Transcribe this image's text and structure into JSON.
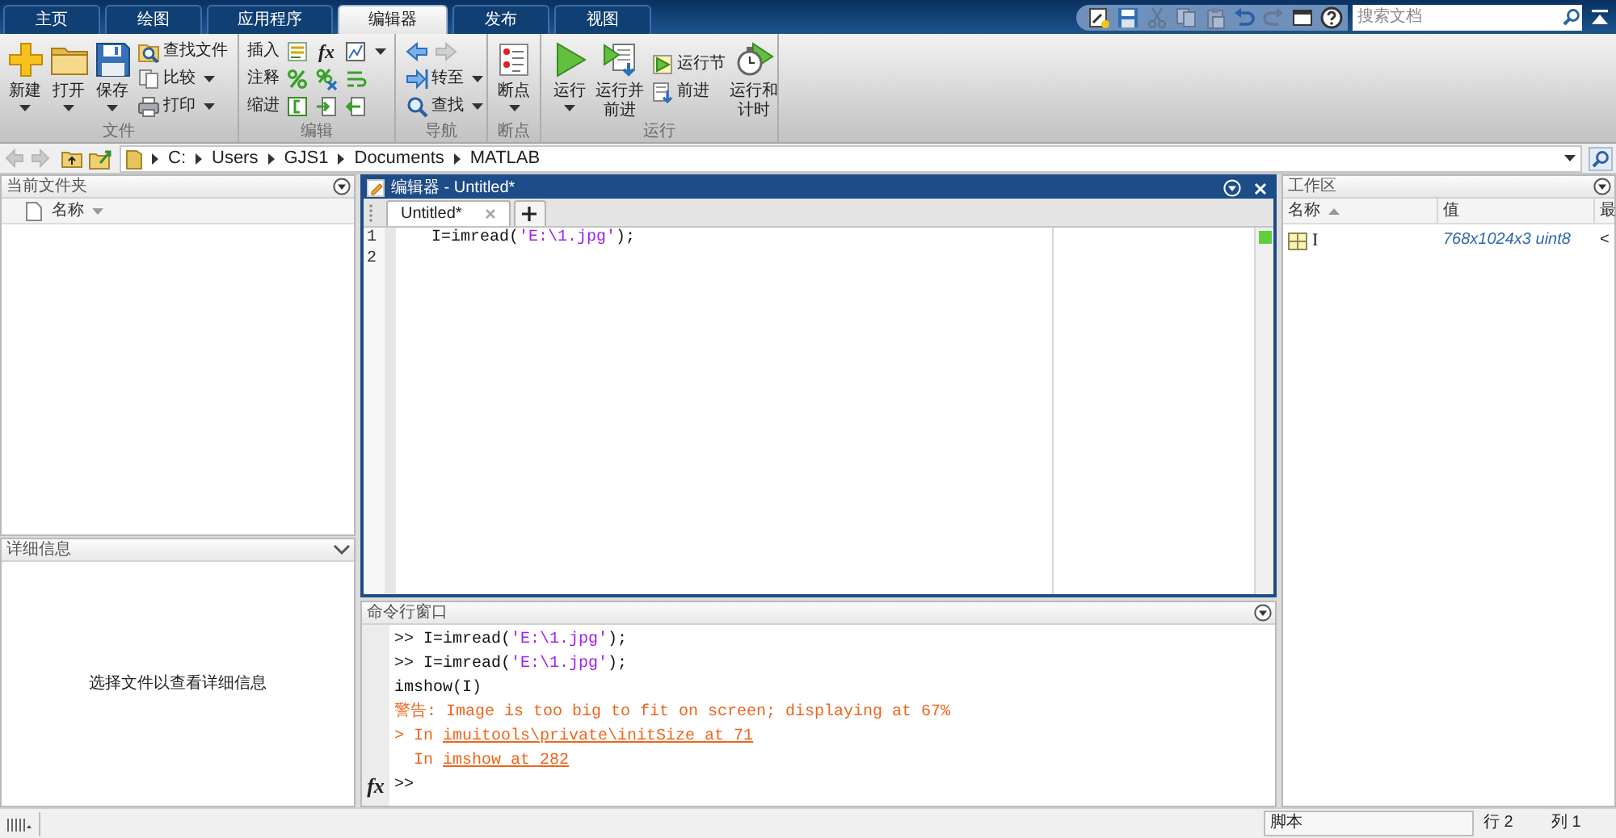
{
  "ribbon_tabs": [
    {
      "label": "主页",
      "selected": false
    },
    {
      "label": "绘图",
      "selected": false
    },
    {
      "label": "应用程序",
      "selected": false
    },
    {
      "label": "编辑器",
      "selected": true
    },
    {
      "label": "发布",
      "selected": false
    },
    {
      "label": "视图",
      "selected": false
    }
  ],
  "quick_access_toolbar": [
    {
      "disabled": false
    },
    {
      "disabled": false
    },
    {
      "disabled": true
    },
    {
      "disabled": true
    },
    {
      "disabled": true
    },
    {
      "disabled": false
    },
    {
      "disabled": true
    },
    {
      "disabled": false
    },
    {
      "disabled": false
    }
  ],
  "documentation_search": {
    "placeholder": "搜索文档"
  },
  "toolstrip": {
    "groups": [
      {
        "label": "文件",
        "items": [
          {
            "kind": "large",
            "label": "新建",
            "dropdown": true
          },
          {
            "kind": "large",
            "label": "打开",
            "dropdown": true
          },
          {
            "kind": "large",
            "label": "保存",
            "dropdown": true
          },
          {
            "kind": "stack",
            "items": [
              {
                "kind": "small",
                "label": "查找文件",
                "dropdown": false
              },
              {
                "kind": "small",
                "label": "比较",
                "dropdown": true
              },
              {
                "kind": "small",
                "label": "打印",
                "dropdown": true
              }
            ]
          }
        ]
      },
      {
        "label": "编辑",
        "items": [
          {
            "kind": "rows",
            "rows": [
              {
                "label": "插入",
                "symbol": "fx",
                "dropdown": true
              },
              {
                "label": "注释",
                "dropdown": false
              },
              {
                "label": "缩进",
                "dropdown": false
              }
            ]
          }
        ]
      },
      {
        "label": "导航",
        "items": [
          {
            "kind": "stack",
            "items": [
              {
                "kind": "arrows",
                "back_disabled": false,
                "forward_disabled": true
              },
              {
                "kind": "small",
                "label": "转至",
                "dropdown": true
              },
              {
                "kind": "small",
                "label": "查找",
                "dropdown": true
              }
            ]
          }
        ]
      },
      {
        "label": "断点",
        "items": [
          {
            "kind": "large",
            "label": "断点",
            "dropdown": true
          }
        ]
      },
      {
        "label": "运行",
        "items": [
          {
            "kind": "large",
            "label": "运行",
            "dropdown": true
          },
          {
            "kind": "large",
            "label": "运行并前进",
            "dropdown": false
          },
          {
            "kind": "stack",
            "items": [
              {
                "kind": "small",
                "label": "运行节",
                "dropdown": false
              },
              {
                "kind": "small",
                "label": "前进",
                "dropdown": false
              }
            ]
          },
          {
            "kind": "large",
            "label": "运行和计时",
            "dropdown": false
          }
        ]
      }
    ]
  },
  "address_bar": {
    "back_disabled": true,
    "forward_disabled": true,
    "path": [
      "C:",
      "Users",
      "GJS1",
      "Documents",
      "MATLAB"
    ]
  },
  "current_folder": {
    "title": "当前文件夹",
    "columns": [
      {
        "label": "名称",
        "sort_descending": true
      }
    ]
  },
  "details": {
    "title": "详细信息",
    "message": "选择文件以查看详细信息"
  },
  "editor": {
    "title": "编辑器 - Untitled*",
    "tabs": [
      {
        "label": "Untitled*",
        "selected": true
      }
    ],
    "lines": [
      {
        "number": "1",
        "tokens": [
          {
            "kind": "code",
            "text": "I=imread("
          },
          {
            "kind": "string",
            "text": "'E:\\1.jpg'"
          },
          {
            "kind": "code",
            "text": ");"
          }
        ]
      },
      {
        "number": "2"
      }
    ]
  },
  "command_window": {
    "title": "命令行窗口",
    "lines": [
      {
        "kind": "input",
        "prompt": ">>",
        "tokens": [
          {
            "kind": "code",
            "text": "I=imread("
          },
          {
            "kind": "string",
            "text": "'E:\\1.jpg'"
          },
          {
            "kind": "code",
            "text": ");"
          }
        ]
      },
      {
        "kind": "input",
        "prompt": ">>",
        "tokens": [
          {
            "kind": "code",
            "text": "I=imread("
          },
          {
            "kind": "string",
            "text": "'E:\\1.jpg'"
          },
          {
            "kind": "code",
            "text": ");"
          }
        ]
      },
      {
        "kind": "input",
        "tokens": [
          {
            "kind": "code",
            "text": "imshow(I)"
          }
        ]
      },
      {
        "kind": "warning",
        "tokens": [
          {
            "kind": "text",
            "text": "警告: Image is too big to fit on screen; displaying at 67%"
          }
        ]
      },
      {
        "kind": "warning",
        "tokens": [
          {
            "kind": "text",
            "text": "> In "
          },
          {
            "kind": "link",
            "text": "imuitools\\private\\initSize at 71"
          }
        ]
      },
      {
        "kind": "warning",
        "indent": true,
        "tokens": [
          {
            "kind": "text",
            "text": "In "
          },
          {
            "kind": "link",
            "text": "imshow at 282"
          }
        ]
      },
      {
        "kind": "prompt",
        "gutter": "fx",
        "prompt": ">>"
      }
    ]
  },
  "workspace": {
    "title": "工作区",
    "columns": [
      {
        "label": "名称",
        "sort_ascending": true
      },
      {
        "label": "值"
      },
      {
        "label": "最"
      }
    ],
    "rows": [
      {
        "cells": [
          "I",
          "768x1024x3 uint8",
          "<"
        ]
      }
    ]
  },
  "status_bar": {
    "mode": "脚本",
    "line": "行 2",
    "column": "列 1"
  }
}
